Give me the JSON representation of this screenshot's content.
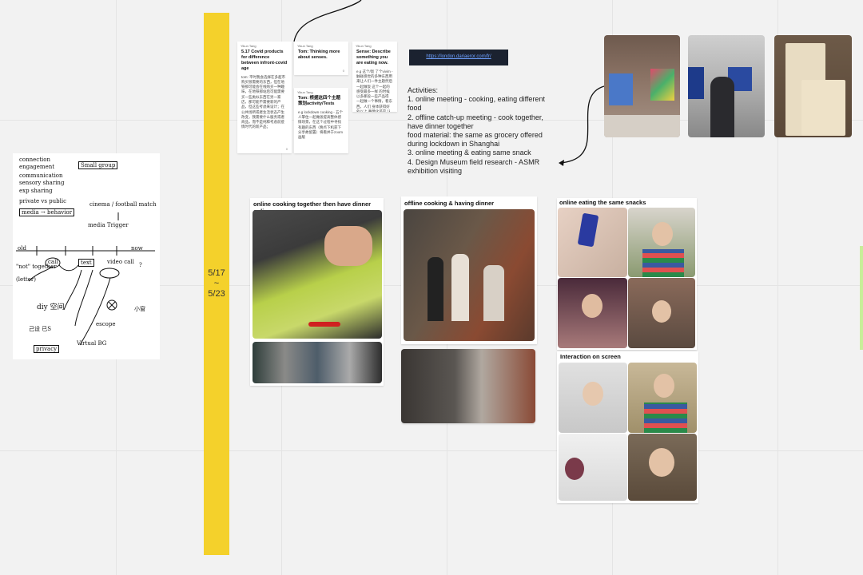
{
  "timeline": {
    "start": "5/17",
    "tilde": "~",
    "end": "5/23"
  },
  "notes": [
    {
      "author": "Yikun Tang",
      "title": "5.17 Covid products for difference between infront-covid age",
      "body": "tom: 平时我会选择在多超市购买很需要的东西，但在地铁那可能会在线购买一种趣味，在地铁那站后可能需要买一些类似东西在另一家店，那可能不需要新的产品，但这些考虑来设计；在公共场所或者生活状态产生改变，我需要什么服务或者商品，而不是纯粹考虑前疫情时代的新产品；",
      "count": "0"
    },
    {
      "author": "Yikun Tang",
      "title": "Tom: Thinking more about senses.",
      "count": "0"
    },
    {
      "author": "Yikun Tang",
      "title": "Tom: 根据这四个主题策划activity/Tests",
      "body": "e.g lockdown cooking - 五个人擎住一起做饭提高整体感情场景，在这个过程中寻找有趣的东西（晚点下机获下分享故留置）将看并于zoom画版"
    },
    {
      "author": "Yikun Tang",
      "title": "Sense: Describe something you are eating now.",
      "body": "e.g 这个/饭 了个vivim - 触碰感觉的多种东西用来让人们一件主题然后一起做饭 这个一起的感受最多一样 的时候以多那段一些产品得 一起做一个事情，看东西，人们 身体获得好处以上 事情化还是 认真看，哪些被推荐？- 互 动，是否有意义？"
    }
  ],
  "link_text": "https://london.dariaeror.com/fr/",
  "activities": {
    "heading": "Activities:",
    "items": [
      "1. online meeting - cooking, eating different food",
      "2. offline catch-up meeting  - cook together, have dinner together",
      "food material: the same as grocery offered during lockdown in Shanghai",
      "3. online meeting & eating same snack",
      "4. Design Museum field research - ASMR exhibition visiting"
    ]
  },
  "groups": {
    "online_cooking": "online cooking together then have dinner online",
    "offline_cooking": "offline cooking & having dinner",
    "online_snacks": "online eating the same snacks",
    "interaction": "Interaction on screen"
  },
  "sketch": {
    "connection": "connection",
    "engagement": "engagement",
    "small_group": "Small group",
    "communication": "communication",
    "sensory_sharing": "sensory sharing",
    "exp_sharing": "exp  sharing",
    "private_public": "private vs public",
    "media_behavior": "media → behavior",
    "cinema": "cinema / football match",
    "media_trigger": "media  Trigger",
    "old": "old",
    "now": "now",
    "not_together": "\"not\" together",
    "letter": "(letter)",
    "call": "call",
    "text": "text",
    "video_call": "video call",
    "question": "?",
    "diy": "diy 空间",
    "escope": "escope",
    "privacy": "privacy",
    "virtual_bg": "Virtual BG",
    "note1": "己设 已S",
    "note2": "小窗"
  },
  "colors": {
    "timeline": "#f4d12b",
    "link_bg": "#1b2230",
    "link_text": "#6ea1ff"
  }
}
